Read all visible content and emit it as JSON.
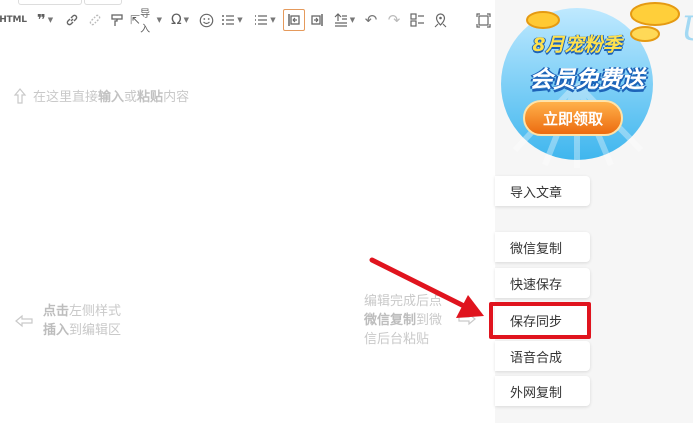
{
  "toolbar": {
    "html_label": "HTML",
    "import_label": "导入",
    "icons": [
      "quote-icon",
      "link-icon",
      "unlink-icon",
      "format-painter-icon",
      "import-icon",
      "special-char-icon",
      "emoji-icon",
      "ordered-list-icon",
      "unordered-list-icon",
      "indent-left-icon",
      "indent-right-icon",
      "line-height-icon",
      "undo-icon",
      "redo-icon",
      "template-icon",
      "map-icon",
      "fullscreen-icon"
    ]
  },
  "editor": {
    "placeholder_prefix": "在这里直接",
    "placeholder_input": "输入",
    "placeholder_or": "或",
    "placeholder_paste": "粘贴",
    "placeholder_suffix": "内容",
    "left_hint_click": "点击",
    "left_hint_rest1": "左侧样式",
    "left_hint_insert": "插入",
    "left_hint_rest2": "到编辑区",
    "right_hint_line1": "编辑完成后点",
    "right_hint_wechat": "微信复制",
    "right_hint_to": "到微",
    "right_hint_line3": "信后台粘贴"
  },
  "banner": {
    "line1": "8月宠粉季",
    "line2": "会员免费送",
    "button": "立即领取",
    "colors": {
      "sky": "#3fb6ee",
      "button": "#f17a1c",
      "text_yellow": "#ffe14d"
    }
  },
  "sidebar": {
    "import_article": "导入文章",
    "wechat_copy": "微信复制",
    "quick_save": "快速保存",
    "save_sync": "保存同步",
    "tts": "语音合成",
    "external_copy": "外网复制"
  },
  "annotation": {
    "color": "#e0141e"
  }
}
